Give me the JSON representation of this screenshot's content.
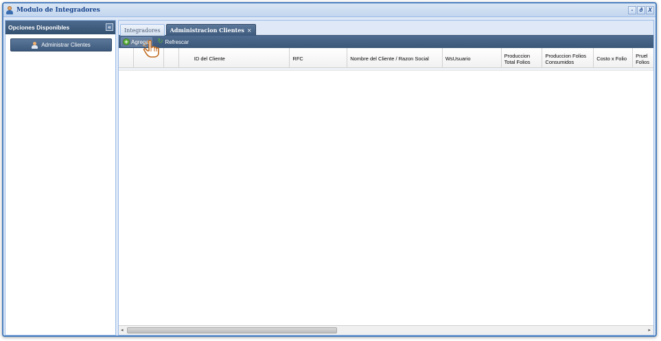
{
  "window": {
    "title": "Modulo de Integradores",
    "controls": [
      "-",
      "ð",
      "X"
    ]
  },
  "sidebar": {
    "header": "Opciones Disponibles",
    "collapse_glyph": "«",
    "items": [
      {
        "label": "Administrar Clientes",
        "icon": "user-icon"
      }
    ]
  },
  "tabs": [
    {
      "label": "Integradores",
      "active": false
    },
    {
      "label": "Administracion Clientes",
      "active": true,
      "close": "×"
    }
  ],
  "toolbar": {
    "add_label": "Agregar",
    "refresh_label": "Refrescar"
  },
  "grid": {
    "columns": [
      "",
      "",
      "",
      "ID del Cliente",
      "RFC",
      "Nombre del Cliente / Razon Social",
      "WsUsuario",
      "Produccion Total Folios",
      "Produccion Folios Consumidos",
      "Costo x Folio",
      "Prueba Folios"
    ],
    "column_headers_visible": {
      "id": "ID del Cliente",
      "rfc": "RFC",
      "nombre": "Nombre del Cliente / Razon Social",
      "wsusuario": "WsUsuario",
      "prod_total": "Produccion Total Folios",
      "prod_consumidos": "Produccion Folios Consumidos",
      "costo": "Costo x Folio",
      "prueba": "Pruel Folios"
    },
    "rows": []
  },
  "scrollbar": {
    "left_arrow": "◂",
    "right_arrow": "▸"
  },
  "colors": {
    "window_border": "#4a7fbe",
    "panel_header": "#3d5a7d",
    "add_icon": "#5bb03c"
  }
}
